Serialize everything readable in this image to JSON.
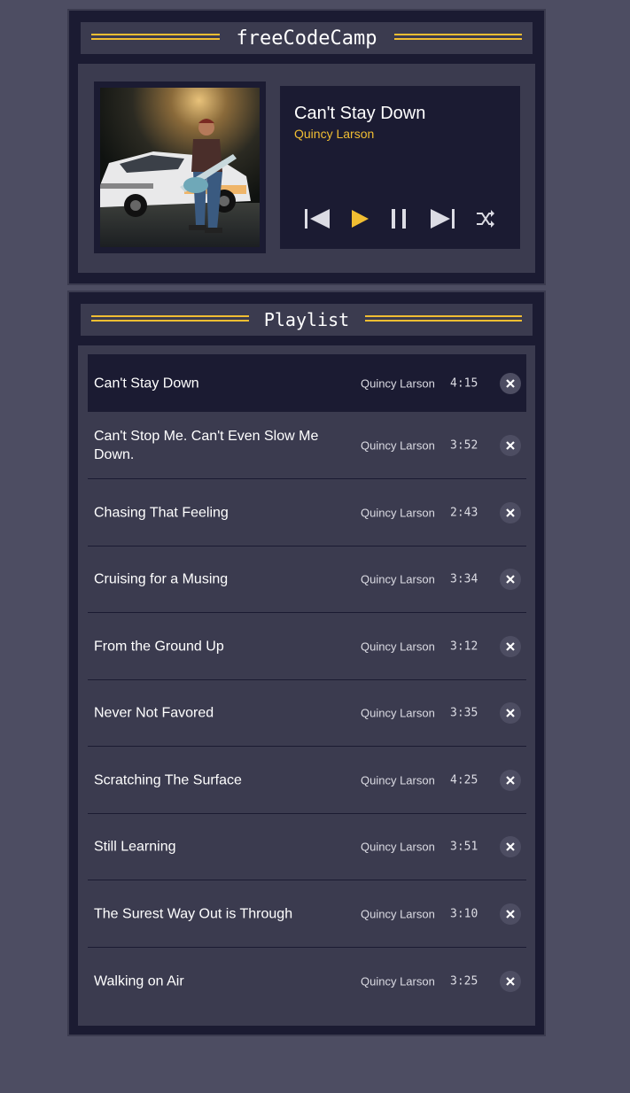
{
  "player": {
    "brand_title": "freeCodeCamp",
    "current_song": {
      "title": "Can't Stay Down",
      "artist": "Quincy Larson"
    },
    "controls": {
      "previous_icon": "skip-previous-icon",
      "play_icon": "play-icon",
      "pause_icon": "pause-icon",
      "next_icon": "skip-next-icon",
      "shuffle_icon": "shuffle-icon"
    }
  },
  "playlist": {
    "title": "Playlist",
    "delete_icon": "close-icon",
    "songs": [
      {
        "title": "Can't Stay Down",
        "artist": "Quincy Larson",
        "duration": "4:15"
      },
      {
        "title": "Can't Stop Me. Can't Even Slow Me Down.",
        "artist": "Quincy Larson",
        "duration": "3:52"
      },
      {
        "title": "Chasing That Feeling",
        "artist": "Quincy Larson",
        "duration": "2:43"
      },
      {
        "title": "Cruising for a Musing",
        "artist": "Quincy Larson",
        "duration": "3:34"
      },
      {
        "title": "From the Ground Up",
        "artist": "Quincy Larson",
        "duration": "3:12"
      },
      {
        "title": "Never Not Favored",
        "artist": "Quincy Larson",
        "duration": "3:35"
      },
      {
        "title": "Scratching The Surface",
        "artist": "Quincy Larson",
        "duration": "4:25"
      },
      {
        "title": "Still Learning",
        "artist": "Quincy Larson",
        "duration": "3:51"
      },
      {
        "title": "The Surest Way Out is Through",
        "artist": "Quincy Larson",
        "duration": "3:10"
      },
      {
        "title": "Walking on Air",
        "artist": "Quincy Larson",
        "duration": "3:25"
      }
    ]
  },
  "colors": {
    "page_bg": "#4d4d62",
    "panel_bg": "#1b1b32",
    "inner_bg": "#3b3b4f",
    "accent": "#f1be32",
    "text": "#ffffff"
  }
}
